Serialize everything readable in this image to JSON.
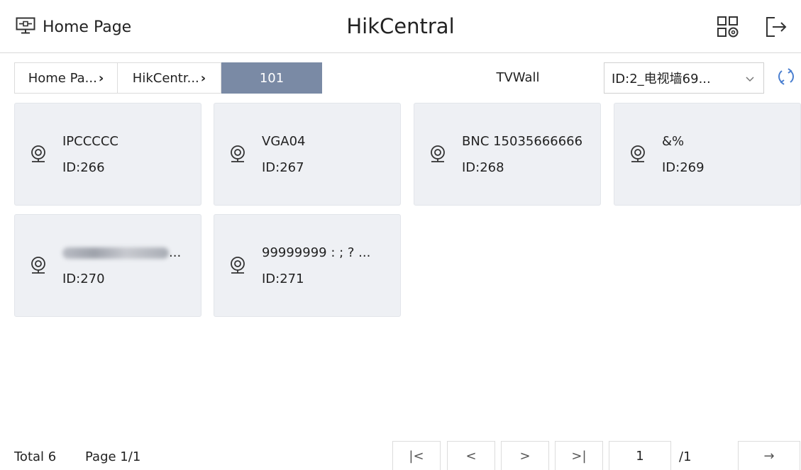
{
  "header": {
    "home_label": "Home Page",
    "title": "HikCentral"
  },
  "breadcrumb": [
    {
      "label": "Home Pa...",
      "active": false
    },
    {
      "label": "HikCentr...",
      "active": false
    },
    {
      "label": "101",
      "active": true
    }
  ],
  "toolbar": {
    "tvwall_label": "TVWall",
    "select_value": "ID:2_电视墙69..."
  },
  "cards": [
    {
      "name": "IPCCCCC",
      "id": "ID:266",
      "blurred": false
    },
    {
      "name": "VGA04",
      "id": "ID:267",
      "blurred": false
    },
    {
      "name": "BNC 15035666666",
      "id": "ID:268",
      "blurred": false
    },
    {
      "name": "&%",
      "id": "ID:269",
      "blurred": false
    },
    {
      "name": "...",
      "id": "ID:270",
      "blurred": true
    },
    {
      "name": "99999999 : ; ? ...",
      "id": "ID:271",
      "blurred": false
    }
  ],
  "footer": {
    "total": "Total 6",
    "page": "Page 1/1",
    "first": "|<",
    "prev": "<",
    "next": ">",
    "last": ">|",
    "page_input": "1",
    "page_total": "/1",
    "go": "→"
  },
  "colors": {
    "active_crumb": "#7a8aa5",
    "card_bg": "#eef0f4"
  }
}
